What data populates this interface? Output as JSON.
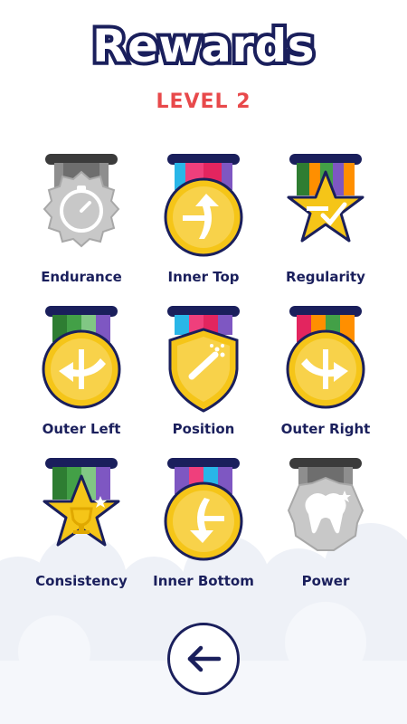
{
  "header": {
    "title": "Rewards",
    "level": "LEVEL 2"
  },
  "medals": [
    {
      "label": "Endurance",
      "icon": "stopwatch-icon",
      "shape": "badge",
      "locked": true
    },
    {
      "label": "Inner Top",
      "icon": "arrow-up-icon",
      "shape": "circle",
      "locked": false
    },
    {
      "label": "Regularity",
      "icon": "checkmark-icon",
      "shape": "star",
      "locked": false
    },
    {
      "label": "Outer Left",
      "icon": "arrow-left-icon",
      "shape": "circle",
      "locked": false
    },
    {
      "label": "Position",
      "icon": "toothbrush-icon",
      "shape": "shield",
      "locked": false
    },
    {
      "label": "Outer Right",
      "icon": "arrow-right-icon",
      "shape": "circle",
      "locked": false
    },
    {
      "label": "Consistency",
      "icon": "trophy-icon",
      "shape": "star",
      "locked": false
    },
    {
      "label": "Inner Bottom",
      "icon": "arrow-down-icon",
      "shape": "circle",
      "locked": false
    },
    {
      "label": "Power",
      "icon": "tooth-icon",
      "shape": "badge",
      "locked": true
    }
  ],
  "colors": {
    "navy": "#1a1f5c",
    "level_red": "#e8494b",
    "gold": "#f5c518",
    "gold_dark": "#e0a800",
    "locked_gray": "#c4c4c4"
  },
  "back_button": {
    "icon": "arrow-left-icon"
  }
}
